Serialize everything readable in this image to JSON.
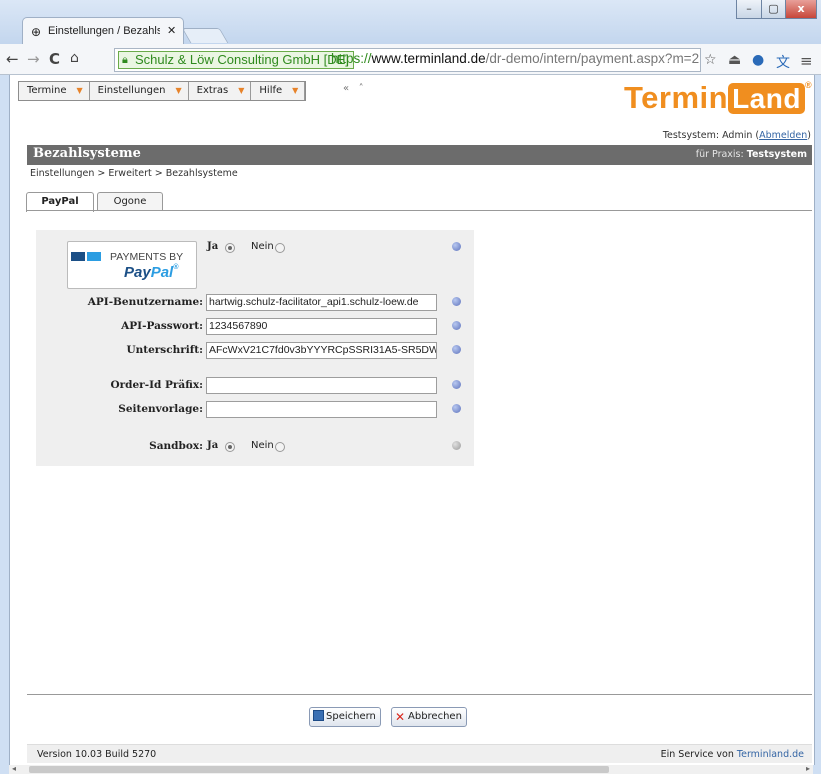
{
  "browser": {
    "tab_title": "Einstellungen / Bezahlsyst",
    "secure_label": "Schulz & Löw Consulting GmbH [DE]",
    "url_scheme": "https://",
    "url_host": "www.terminland.de",
    "url_path": "/dr-demo/intern/payment.aspx?m=2"
  },
  "menu": [
    {
      "label": "Termine"
    },
    {
      "label": "Einstellungen"
    },
    {
      "label": "Extras"
    },
    {
      "label": "Hilfe"
    }
  ],
  "logo": {
    "part1": "Termin",
    "part2": "Land",
    "reg": "®"
  },
  "user": {
    "prefix": "Testsystem: Admin (",
    "logout": "Abmelden",
    "suffix": ")"
  },
  "header": {
    "title": "Bezahlsysteme",
    "praxis_label": "für Praxis:",
    "praxis_value": "Testsystem"
  },
  "breadcrumb": "Einstellungen > Erweitert > Bezahlsysteme",
  "tabs": [
    {
      "label": "PayPal",
      "active": true
    },
    {
      "label": "Ogone",
      "active": false
    }
  ],
  "paypal_logo": {
    "line1": "PAYMENTS BY",
    "line2a": "Pay",
    "line2b": "Pal",
    "line2c": "®"
  },
  "form": {
    "enabled": {
      "yes": "Ja",
      "no": "Nein",
      "selected": "Ja"
    },
    "api_user_label": "API-Benutzername:",
    "api_user_value": "hartwig.schulz-facilitator_api1.schulz-loew.de",
    "api_pass_label": "API-Passwort:",
    "api_pass_value": "1234567890",
    "signature_label": "Unterschrift:",
    "signature_value": "AFcWxV21C7fd0v3bYYYRCpSSRI31A5-SR5DW",
    "order_prefix_label": "Order-Id Präfix:",
    "order_prefix_value": "",
    "template_label": "Seitenvorlage:",
    "template_value": "",
    "sandbox_label": "Sandbox:",
    "sandbox": {
      "yes": "Ja",
      "no": "Nein",
      "selected": "Ja"
    }
  },
  "buttons": {
    "save": "Speichern",
    "cancel": "Abbrechen"
  },
  "footer": {
    "version": "Version 10.03 Build 5270",
    "service_prefix": "Ein Service von ",
    "service_link": "Terminland.de"
  },
  "colors": {
    "accent": "#f08e1f",
    "header_bar": "#6c6c6c",
    "link": "#3465a4"
  }
}
